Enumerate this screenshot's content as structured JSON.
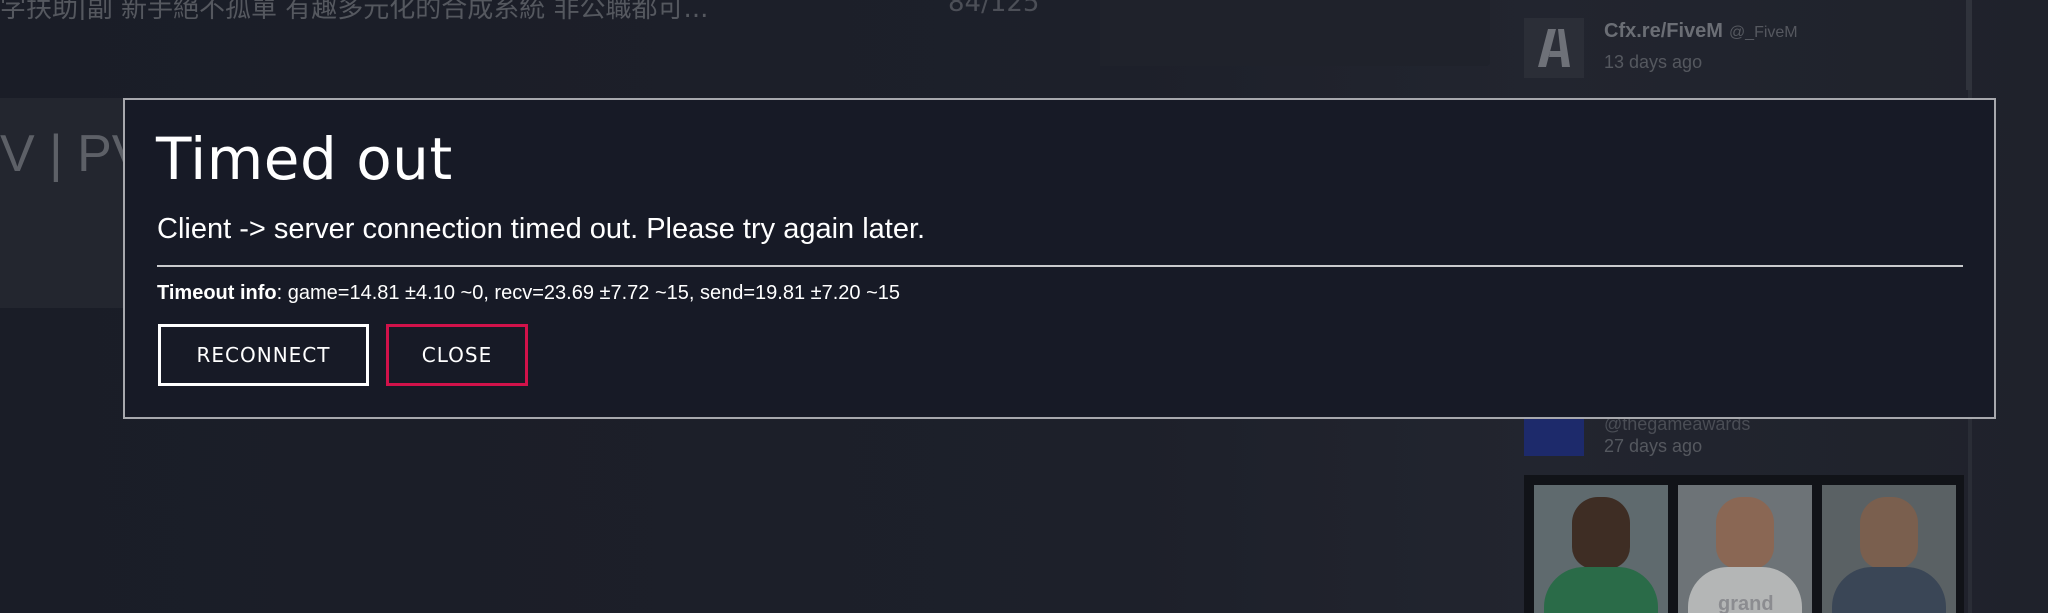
{
  "background": {
    "server_name": "字扶助|副 新手絕不孤單 有趣多元化的合成系統 非公職都可...",
    "player_count": "84/125",
    "partial_title": "V | PV",
    "feed": [
      {
        "name": "Cfx.re/FiveM",
        "handle": "@_FiveM",
        "time": "13 days ago"
      },
      {
        "handle": "@thegameawards",
        "time": "27 days ago"
      }
    ],
    "promo_label": "grand"
  },
  "modal": {
    "title": "Timed out",
    "message": "Client -> server connection timed out. Please try again later.",
    "info_label": "Timeout info",
    "info_value": ": game=14.81 ±4.10 ~0, recv=23.69 ±7.72 ~15, send=19.81 ±7.20 ~15",
    "reconnect_label": "RECONNECT",
    "close_label": "CLOSE"
  },
  "colors": {
    "modal_bg": "#171a26",
    "modal_border": "#a7a8ad",
    "close_border": "#d1124a",
    "reconnect_border": "#ffffff"
  }
}
